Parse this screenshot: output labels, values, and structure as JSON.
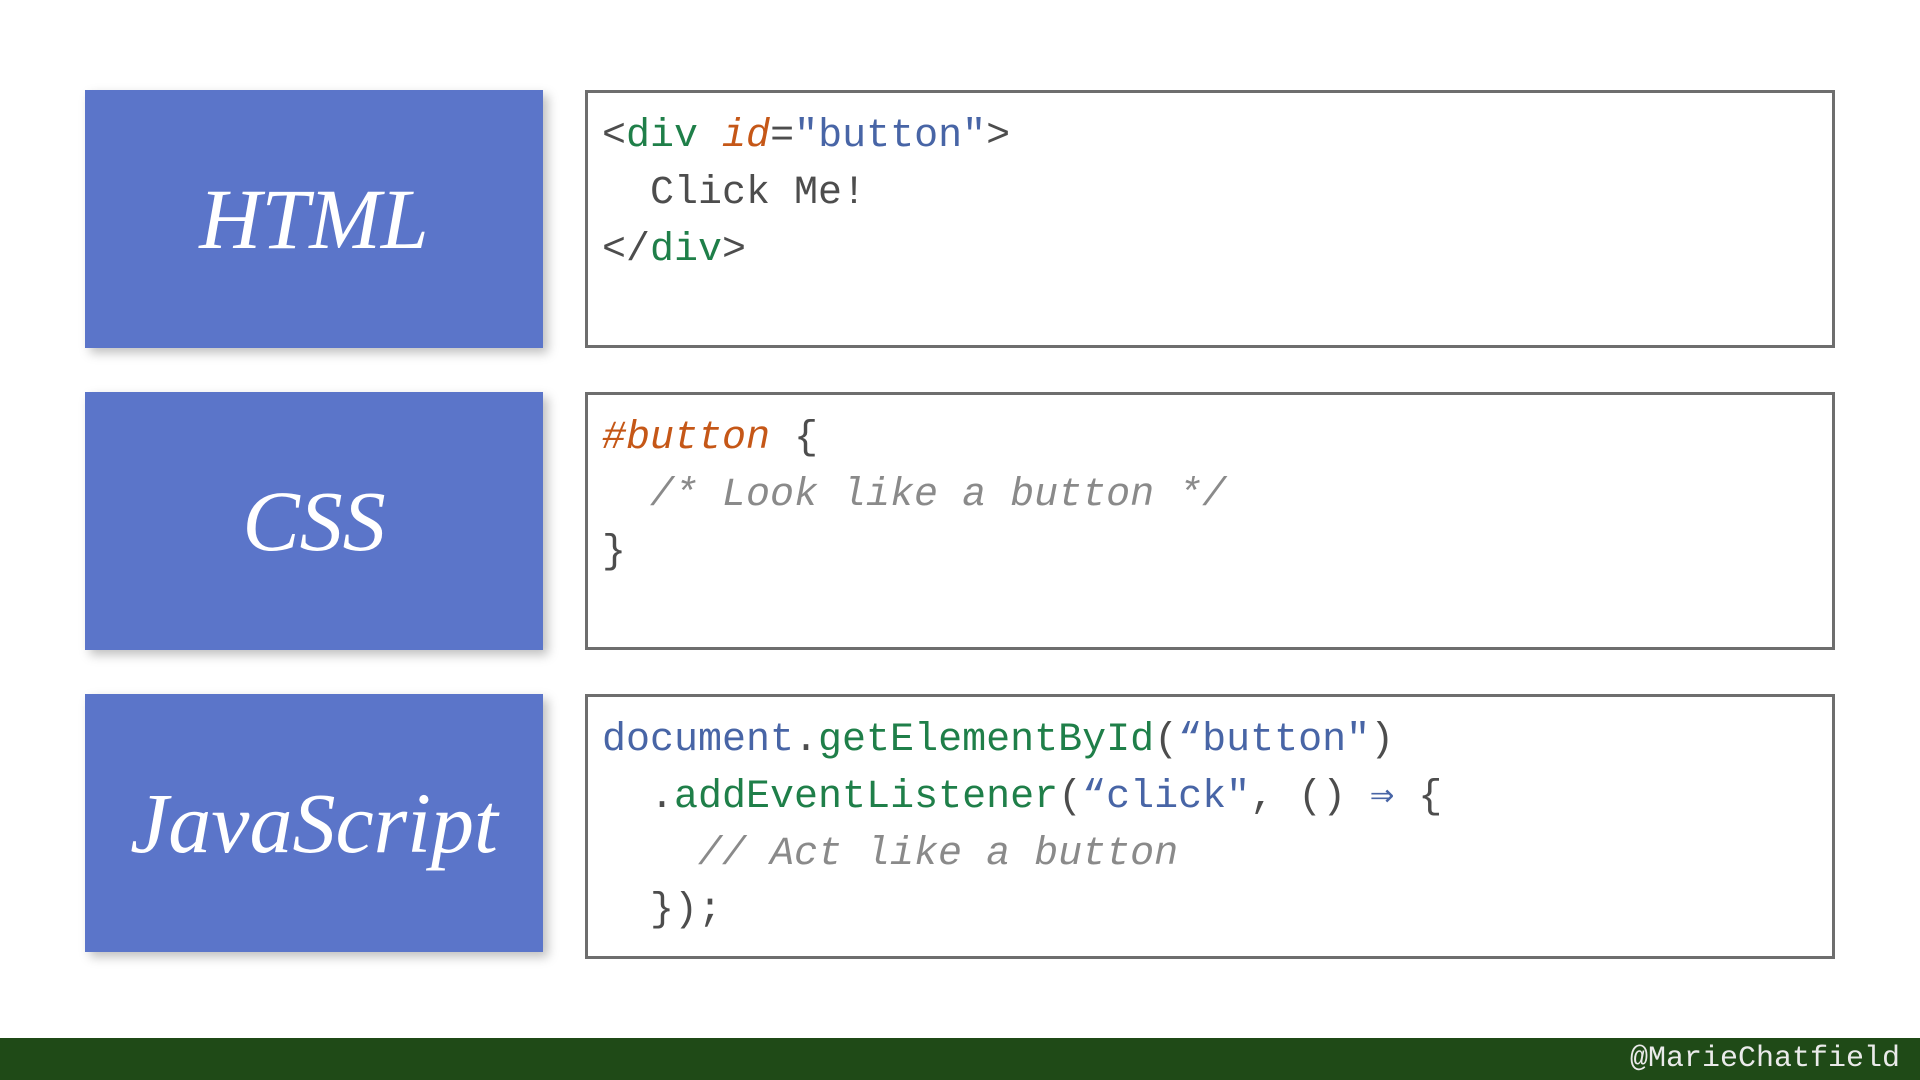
{
  "rows": [
    {
      "label": "HTML"
    },
    {
      "label": "CSS"
    },
    {
      "label": "JavaScript"
    }
  ],
  "code": {
    "html": {
      "tag_open": "div",
      "attr_name": "id",
      "attr_value": "\"button\"",
      "inner_text": "Click Me!",
      "tag_close": "div"
    },
    "css": {
      "selector": "#button",
      "brace_open": "{",
      "comment": "/* Look like a button */",
      "brace_close": "}"
    },
    "js": {
      "obj": "document",
      "dot1": ".",
      "method1": "getElementById",
      "paren1_open": "(",
      "arg1": "“button\"",
      "paren1_close": ")",
      "dot2": ".",
      "method2": "addEventListener",
      "paren2_open": "(",
      "arg2": "“click\"",
      "comma": ", ",
      "arrow_params": "()",
      "arrow": " ⇒ ",
      "brace_open": "{",
      "comment": "// Act like a button",
      "brace_close": "}",
      "paren2_close": ")",
      "semi": ";"
    }
  },
  "footer": {
    "handle": "@MarieChatfield"
  }
}
